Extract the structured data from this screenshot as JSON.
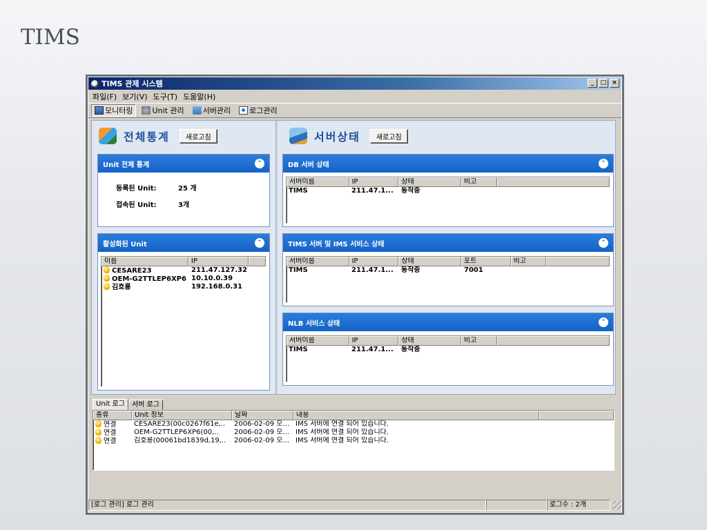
{
  "slide": {
    "title": "TIMS"
  },
  "window": {
    "title": "TIMS 관제 시스템",
    "minimize": "_",
    "maximize": "□",
    "close": "×"
  },
  "menu": [
    "파일(F)",
    "보기(V)",
    "도구(T)",
    "도움말(H)"
  ],
  "toolbar": {
    "monitoring": "모니터링",
    "unit_mgmt": "Unit 관리",
    "server_mgmt": "서버관리",
    "log_mgmt": "로그관리"
  },
  "stats": {
    "heading": "전체통계",
    "refresh": "새로고침",
    "unit_panel": {
      "title": "Unit 전체 통계",
      "registered_label": "등록된 Unit:",
      "registered_value": "25 개",
      "connected_label": "접속된 Unit:",
      "connected_value": "3개"
    },
    "active_panel": {
      "title": "활성화된 Unit",
      "columns": [
        "이름",
        "IP",
        ""
      ],
      "rows": [
        {
          "name": "CESARE23",
          "ip": "211.47.127.32"
        },
        {
          "name": "OEM-G2TTLEP6XP6",
          "ip": "10.10.0.39"
        },
        {
          "name": "김호룡",
          "ip": "192.168.0.31"
        }
      ]
    }
  },
  "server": {
    "heading": "서버상태",
    "refresh": "새로고침",
    "db_panel": {
      "title": "DB 서버 상태",
      "columns": [
        "서버이름",
        "IP",
        "상태",
        "비고",
        ""
      ],
      "rows": [
        {
          "name": "TIMS",
          "ip": "211.47.1...",
          "status": "동작중",
          "note": ""
        }
      ]
    },
    "tims_panel": {
      "title": "TIMS 서버 및 IMS 서비스 상태",
      "columns": [
        "서버이름",
        "IP",
        "상태",
        "포트",
        "비고",
        ""
      ],
      "rows": [
        {
          "name": "TIMS",
          "ip": "211.47.1...",
          "status": "동작중",
          "port": "7001",
          "note": ""
        }
      ]
    },
    "nlb_panel": {
      "title": "NLB 서비스 상태",
      "columns": [
        "서버이름",
        "IP",
        "상태",
        "비고",
        ""
      ],
      "rows": [
        {
          "name": "TIMS",
          "ip": "211.47.1...",
          "status": "동작중",
          "note": ""
        }
      ]
    }
  },
  "log": {
    "tabs": [
      "Unit 로그",
      "서버 로그"
    ],
    "columns": [
      "종류",
      "Unit 정보",
      "날짜",
      "내용",
      ""
    ],
    "rows": [
      {
        "type": "연결",
        "unit": "CESARE23(00c0267f61e,..",
        "date": "2006-02-09 오...",
        "content": "IMS 서버에 연결 되어 있습니다."
      },
      {
        "type": "연결",
        "unit": "OEM-G2TTLEP6XP6(00,..",
        "date": "2006-02-09 오...",
        "content": "IMS 서버에 연결 되어 있습니다."
      },
      {
        "type": "연결",
        "unit": "김호룡(00061bd1839d,19,..",
        "date": "2006-02-09 오...",
        "content": "IMS 서버에 연결 되어 있습니다."
      }
    ]
  },
  "status": {
    "left": "[로그 관리] 로그 관리",
    "right": "로그수 : 2개"
  }
}
